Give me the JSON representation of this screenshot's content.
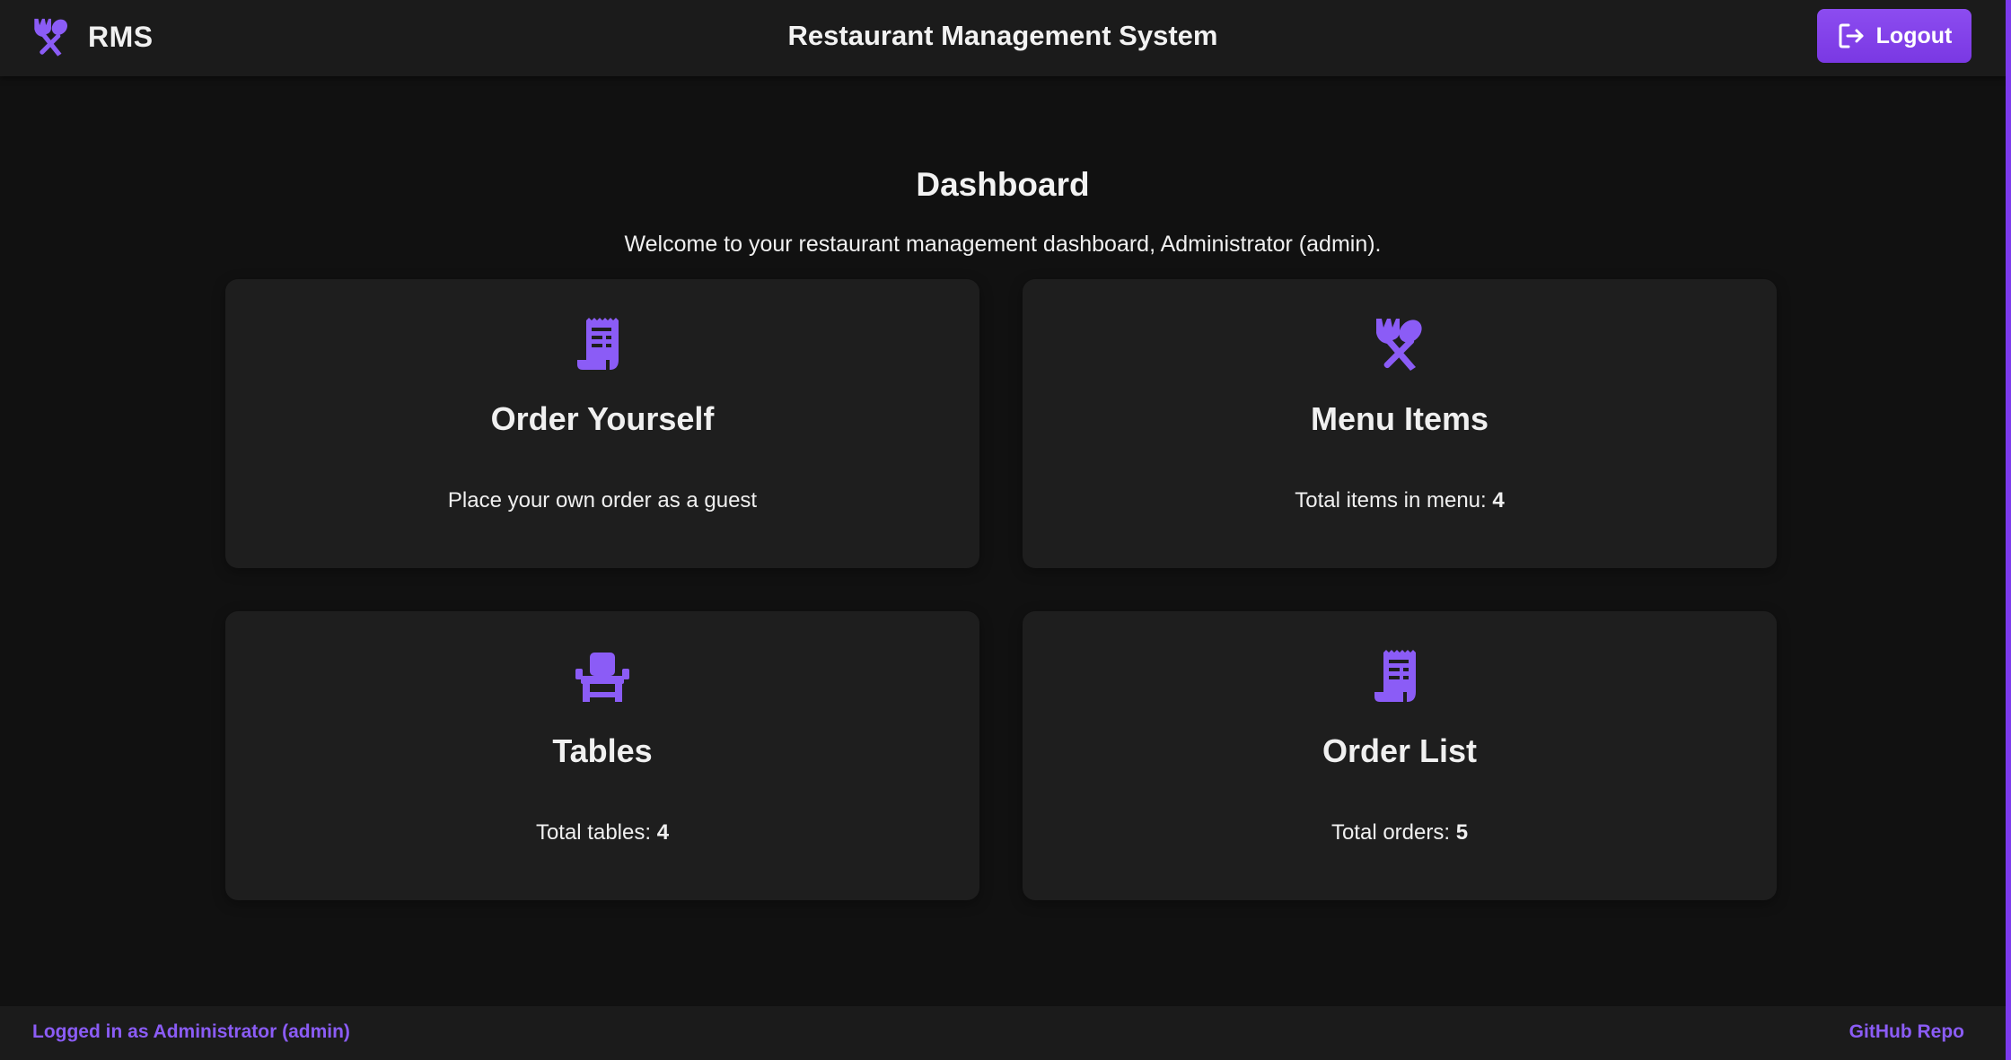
{
  "header": {
    "brand": "RMS",
    "title": "Restaurant Management System",
    "logout_label": "Logout"
  },
  "colors": {
    "accent": "#8b5cf6",
    "button": "#7c3aed",
    "background": "#111111",
    "card": "#1e1e1e"
  },
  "dashboard": {
    "title": "Dashboard",
    "welcome": "Welcome to your restaurant management dashboard, Administrator (admin).",
    "cards": [
      {
        "icon": "receipt-icon",
        "title": "Order Yourself",
        "text": "Place your own order as a guest",
        "value": ""
      },
      {
        "icon": "utensils-icon",
        "title": "Menu Items",
        "text": "Total items in menu: ",
        "value": "4"
      },
      {
        "icon": "chair-icon",
        "title": "Tables",
        "text": "Total tables: ",
        "value": "4"
      },
      {
        "icon": "receipt-icon",
        "title": "Order List",
        "text": "Total orders: ",
        "value": "5"
      }
    ]
  },
  "footer": {
    "logged_in": "Logged in as Administrator (admin)",
    "repo_link": "GitHub Repo"
  }
}
